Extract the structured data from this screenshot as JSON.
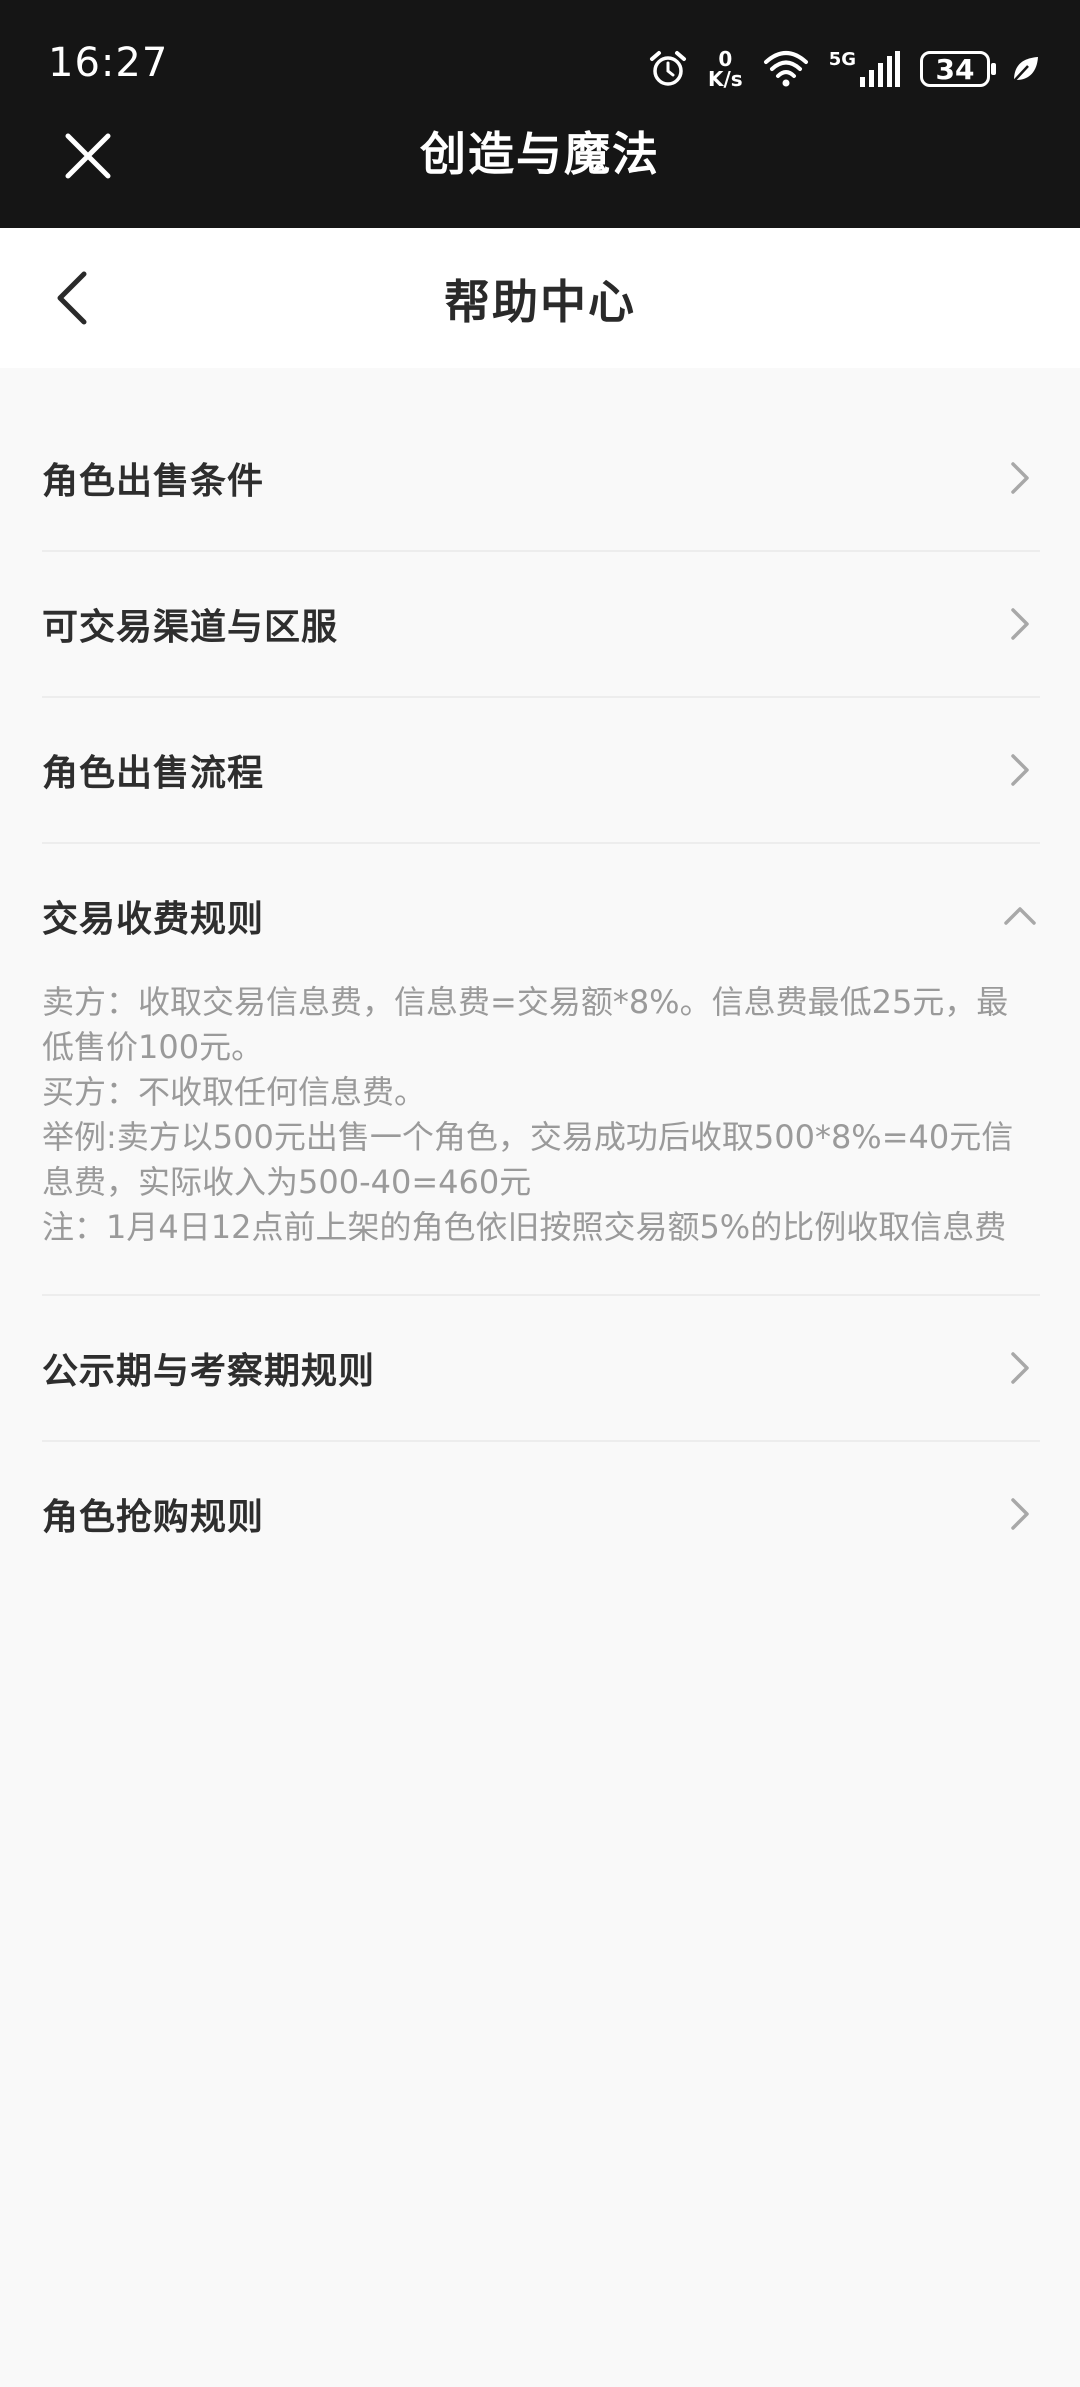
{
  "status_bar": {
    "time": "16:27",
    "net_speed_value": "0",
    "net_speed_unit": "K/s",
    "network_type": "5G",
    "battery": "34"
  },
  "webview": {
    "title": "创造与魔法"
  },
  "header": {
    "title": "帮助中心"
  },
  "faq": [
    {
      "title": "角色出售条件",
      "expanded": false
    },
    {
      "title": "可交易渠道与区服",
      "expanded": false
    },
    {
      "title": "角色出售流程",
      "expanded": false
    },
    {
      "title": "交易收费规则",
      "expanded": true,
      "lines": [
        "卖方：收取交易信息费，信息费=交易额*8%。信息费最低25元，最低售价100元。",
        "买方：不收取任何信息费。",
        "举例:卖方以500元出售一个角色，交易成功后收取500*8%=40元信息费，实际收入为500-40=460元",
        "注：1月4日12点前上架的角色依旧按照交易额5%的比例收取信息费"
      ]
    },
    {
      "title": "公示期与考察期规则",
      "expanded": false
    },
    {
      "title": "角色抢购规则",
      "expanded": false
    }
  ],
  "colors": {
    "top_bar": "#151515",
    "background": "#f9f9f9",
    "title_text": "#2e2e2e",
    "body_text": "#9a9a9a",
    "divider": "#ededed"
  }
}
